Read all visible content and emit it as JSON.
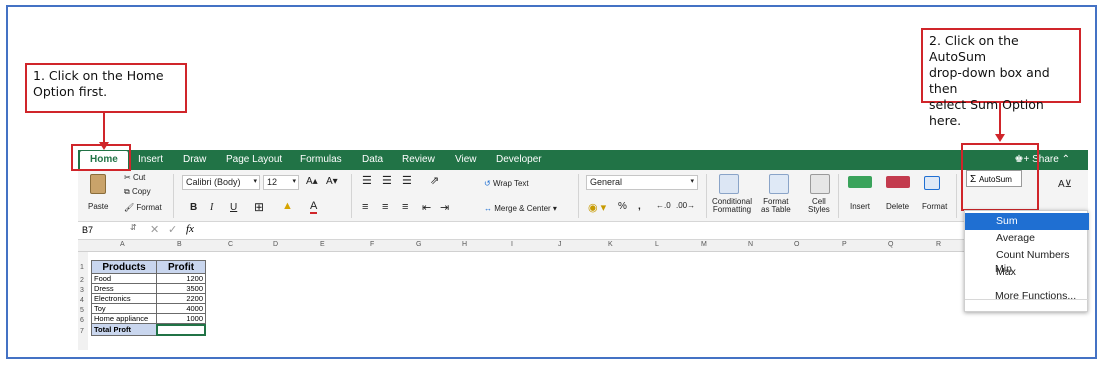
{
  "callouts": {
    "step1": "1. Click on the Home\nOption first.",
    "step2": "2. Click on the AutoSum\ndrop-down box and then\nselect Sum Option here."
  },
  "tabs": [
    "Home",
    "Insert",
    "Draw",
    "Page Layout",
    "Formulas",
    "Data",
    "Review",
    "View",
    "Developer"
  ],
  "share_label": "Share",
  "ribbon": {
    "paste": "Paste",
    "cut": "Cut",
    "copy": "Copy",
    "format_painter": "Format",
    "font_name": "Calibri (Body)",
    "font_size": "12",
    "bold": "B",
    "italic": "I",
    "underline": "U",
    "wrap_text": "Wrap Text",
    "merge_center": "Merge & Center",
    "number_format": "General",
    "percent": "%",
    "comma": ",",
    "conditional_formatting": "Conditional\nFormatting",
    "format_as_table": "Format\nas Table",
    "cell_styles": "Cell\nStyles",
    "insert": "Insert",
    "delete": "Delete",
    "format": "Format",
    "autosum": "AutoSum"
  },
  "formula_bar": {
    "name_box": "B7",
    "fx": "fx",
    "value": ""
  },
  "columns": [
    "A",
    "B",
    "C",
    "D",
    "E",
    "F",
    "G",
    "H",
    "I",
    "J",
    "K",
    "L",
    "M",
    "N",
    "O",
    "P",
    "Q",
    "R"
  ],
  "rows": [
    "1",
    "2",
    "3",
    "4",
    "5",
    "6",
    "7"
  ],
  "table": {
    "headers": [
      "Products",
      "Profit"
    ],
    "rows": [
      [
        "Food",
        "1200"
      ],
      [
        "Dress",
        "3500"
      ],
      [
        "Electronics",
        "2200"
      ],
      [
        "Toy",
        "4000"
      ],
      [
        "Home appliance",
        "1000"
      ]
    ],
    "total_label": "Total Proft",
    "total_value": ""
  },
  "autosum_menu": {
    "items": [
      "Sum",
      "Average",
      "Count Numbers",
      "Max",
      "Min"
    ],
    "more": "More Functions...",
    "selected": "Sum"
  },
  "colors": {
    "excel_green": "#217346",
    "callout_red": "#d0252a",
    "frame_blue": "#4472c4",
    "menu_selected": "#1f6fd2",
    "table_header": "#c9d6ee"
  }
}
